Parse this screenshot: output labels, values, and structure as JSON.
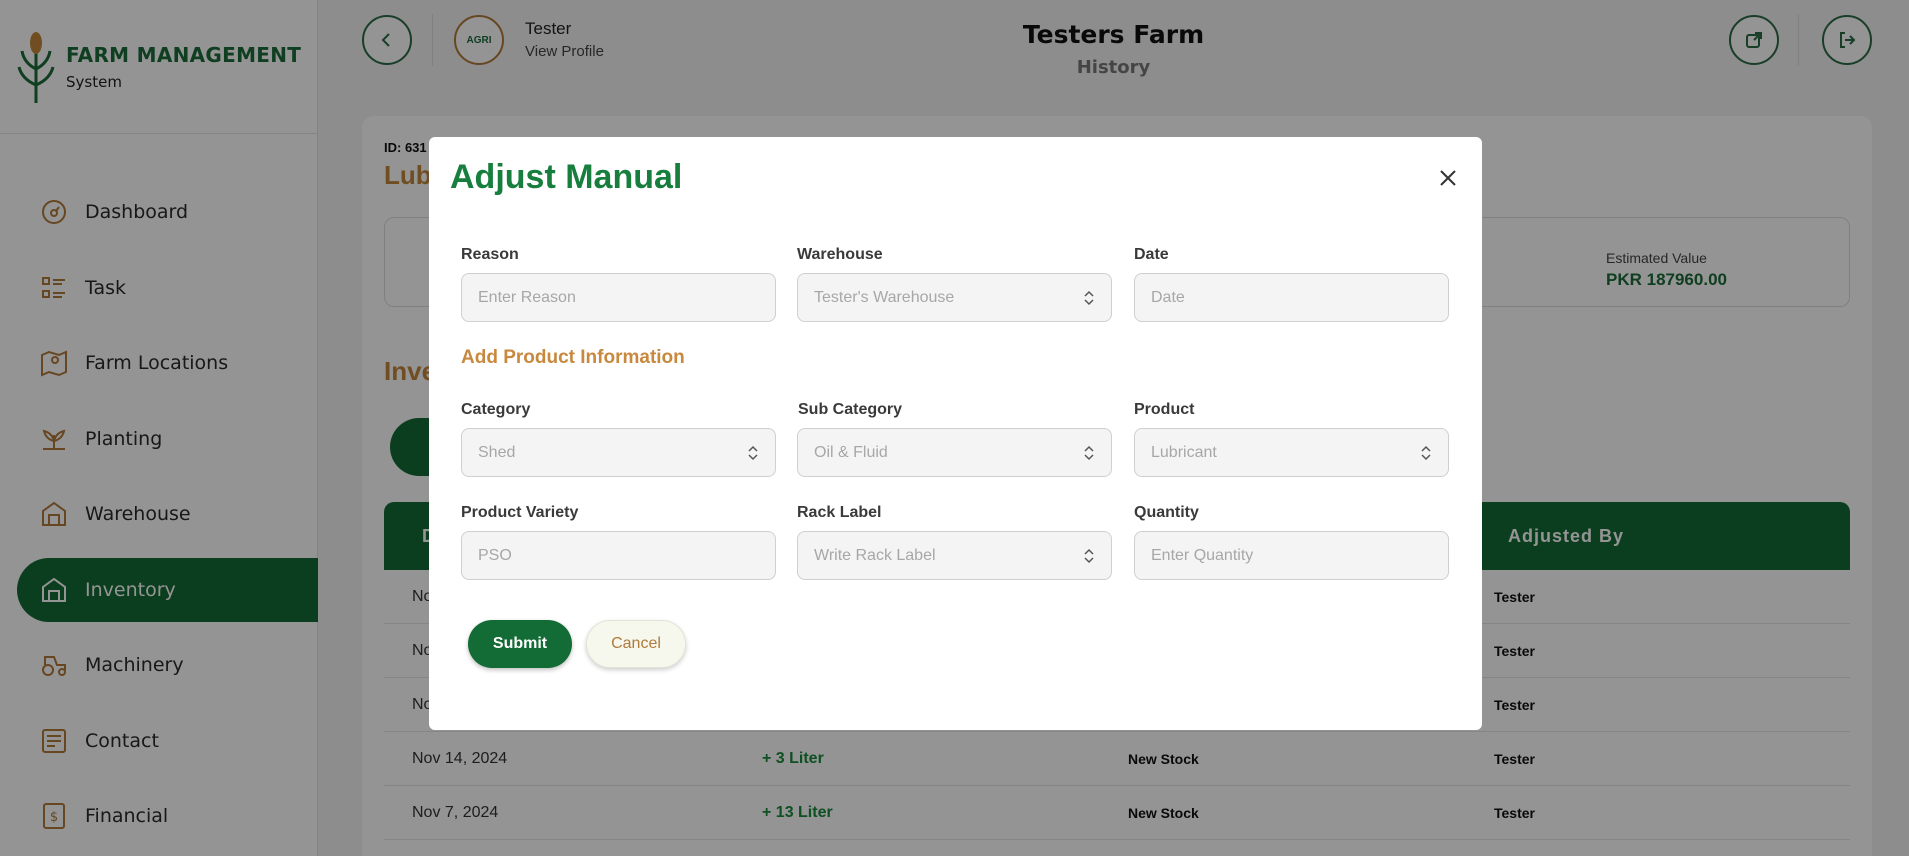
{
  "app": {
    "brand_title": "FARM MANAGEMENT",
    "brand_sub": "System"
  },
  "sidebar": {
    "items": [
      {
        "label": "Dashboard",
        "icon": "dashboard-icon"
      },
      {
        "label": "Task",
        "icon": "task-icon"
      },
      {
        "label": "Farm Locations",
        "icon": "map-icon"
      },
      {
        "label": "Planting",
        "icon": "plant-icon"
      },
      {
        "label": "Warehouse",
        "icon": "warehouse-icon"
      },
      {
        "label": "Inventory",
        "icon": "inventory-icon",
        "active": true
      },
      {
        "label": "Machinery",
        "icon": "tractor-icon"
      },
      {
        "label": "Contact",
        "icon": "contact-icon"
      },
      {
        "label": "Financial",
        "icon": "financial-icon"
      }
    ]
  },
  "header": {
    "user_name": "Tester",
    "user_link": "View Profile",
    "avatar_text": "AGRI",
    "farm_title": "Testers Farm",
    "farm_sub": "History"
  },
  "background": {
    "record_id": "ID: 631",
    "record_name": "Lub",
    "estimated_label": "Estimated Value",
    "estimated_value": "PKR 187960.00",
    "inventory_title": "Inve",
    "table_header_first": "D",
    "table_header_adjusted": "Adjusted By",
    "rows": [
      {
        "date": "No",
        "qty": "",
        "reason": "",
        "by": "Tester"
      },
      {
        "date": "No",
        "qty": "",
        "reason": "",
        "by": "Tester"
      },
      {
        "date": "No",
        "qty": "",
        "reason": "",
        "by": "Tester"
      },
      {
        "date": "Nov 14, 2024",
        "qty": "+ 3 Liter",
        "reason": "New Stock",
        "by": "Tester"
      },
      {
        "date": "Nov 7, 2024",
        "qty": "+ 13 Liter",
        "reason": "New Stock",
        "by": "Tester"
      }
    ]
  },
  "modal": {
    "title": "Adjust Manual",
    "section_title": "Add Product Information",
    "fields": {
      "reason": {
        "label": "Reason",
        "placeholder": "Enter Reason"
      },
      "warehouse": {
        "label": "Warehouse",
        "value": "Tester's Warehouse"
      },
      "date": {
        "label": "Date",
        "placeholder": "Date"
      },
      "category": {
        "label": "Category",
        "value": "Shed"
      },
      "sub_category": {
        "label": "Sub Category",
        "value": "Oil & Fluid"
      },
      "product": {
        "label": "Product",
        "value": "Lubricant"
      },
      "product_variety": {
        "label": "Product Variety",
        "placeholder": "PSO"
      },
      "rack_label": {
        "label": "Rack Label",
        "value": "Write Rack Label"
      },
      "quantity": {
        "label": "Quantity",
        "placeholder": "Enter Quantity"
      }
    },
    "submit_label": "Submit",
    "cancel_label": "Cancel"
  },
  "colors": {
    "primary_green": "#136b35",
    "accent_gold": "#c8893e"
  }
}
